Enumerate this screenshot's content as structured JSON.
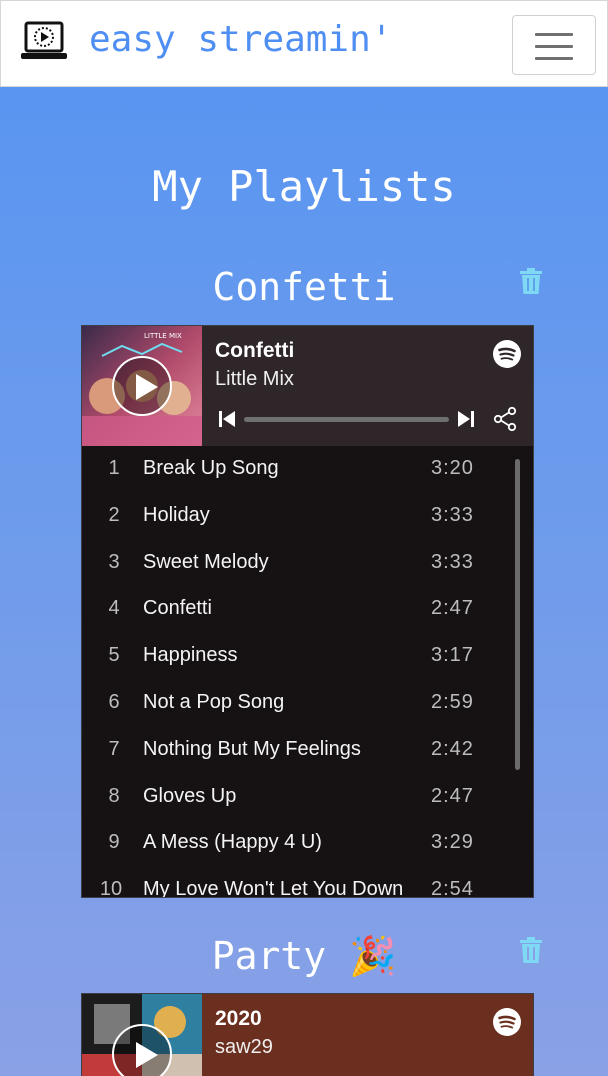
{
  "nav": {
    "brand": "easy streamin'"
  },
  "page": {
    "title": "My Playlists"
  },
  "playlists": [
    {
      "title": "Confetti",
      "player": {
        "track": "Confetti",
        "artist": "Little Mix",
        "header_color": "#2e2628",
        "cover_text": "LITTLE MIX",
        "tracks": [
          {
            "num": "1",
            "name": "Break Up Song",
            "duration": "3:20"
          },
          {
            "num": "2",
            "name": "Holiday",
            "duration": "3:33"
          },
          {
            "num": "3",
            "name": "Sweet Melody",
            "duration": "3:33"
          },
          {
            "num": "4",
            "name": "Confetti",
            "duration": "2:47"
          },
          {
            "num": "5",
            "name": "Happiness",
            "duration": "3:17"
          },
          {
            "num": "6",
            "name": "Not a Pop Song",
            "duration": "2:59"
          },
          {
            "num": "7",
            "name": "Nothing But My Feelings",
            "duration": "2:42"
          },
          {
            "num": "8",
            "name": "Gloves Up",
            "duration": "2:47"
          },
          {
            "num": "9",
            "name": "A Mess (Happy 4 U)",
            "duration": "3:29"
          },
          {
            "num": "10",
            "name": "My Love Won't Let You Down",
            "duration": "2:54"
          }
        ]
      }
    },
    {
      "title": "Party 🎉",
      "player": {
        "track": "2020",
        "artist": "saw29",
        "header_color": "#6b2f1f"
      }
    }
  ],
  "colors": {
    "brand": "#4f8ef2",
    "trash": "#7fd9f5",
    "background_top": "#5594f2",
    "background_bottom": "#8aa1e6"
  },
  "icons": {
    "brand": "laptop-play-icon",
    "menu": "hamburger-icon",
    "delete": "trash-icon",
    "spotify": "spotify-icon",
    "play": "play-icon",
    "previous": "skip-previous-icon",
    "next": "skip-next-icon",
    "share": "share-icon"
  }
}
